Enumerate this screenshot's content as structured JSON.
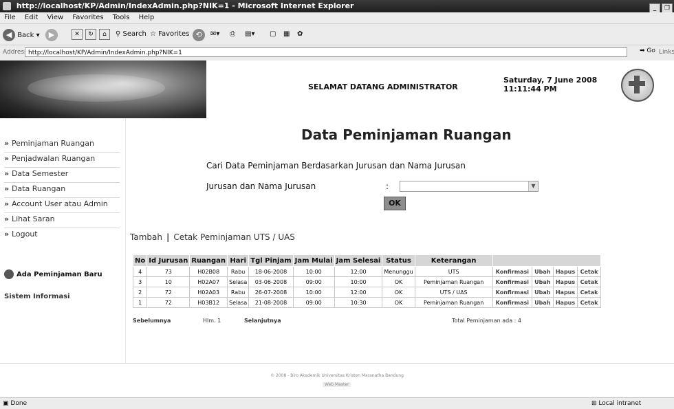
{
  "window": {
    "title": "http://localhost/KP/Admin/IndexAdmin.php?NIK=1 - Microsoft Internet Explorer"
  },
  "menu": [
    "File",
    "Edit",
    "View",
    "Favorites",
    "Tools",
    "Help"
  ],
  "toolbar": {
    "back": "Back",
    "search": "Search",
    "favorites": "Favorites"
  },
  "address": {
    "label": "Address",
    "url": "http://localhost/KP/Admin/IndexAdmin.php?NIK=1",
    "go": "Go",
    "links": "Links"
  },
  "header": {
    "welcome": "SELAMAT DATANG ADMINISTRATOR",
    "date": "Saturday, 7 June 2008",
    "time": "11:11:44 PM"
  },
  "sidebar": {
    "items": [
      {
        "label": "Peminjaman Ruangan"
      },
      {
        "label": "Penjadwalan Ruangan"
      },
      {
        "label": "Data Semester"
      },
      {
        "label": "Data Ruangan"
      },
      {
        "label": "Account User atau Admin"
      },
      {
        "label": "Lihat Saran"
      },
      {
        "label": "Logout"
      }
    ],
    "notice": "Ada Peminjaman Baru",
    "system": "Sistem Informasi"
  },
  "main": {
    "title": "Data Peminjaman Ruangan",
    "search_heading": "Cari Data Peminjaman Berdasarkan Jurusan dan Nama Jurusan",
    "field_label": "Jurusan dan Nama Jurusan",
    "colon": ":",
    "select_value": "",
    "ok": "OK",
    "add_link": "Tambah",
    "separator": "|",
    "print_link": "Cetak Peminjaman UTS / UAS"
  },
  "table": {
    "headers": [
      "No",
      "Id Jurusan",
      "Ruangan",
      "Hari",
      "Tgl Pinjam",
      "Jam Mulai",
      "Jam Selesai",
      "Status",
      "Keterangan",
      ""
    ],
    "rows": [
      {
        "no": "4",
        "id": "73",
        "ruangan": "H02B08",
        "hari": "Rabu",
        "tgl": "18-06-2008",
        "mulai": "10:00",
        "selesai": "12:00",
        "status": "Menunggu",
        "ket": "UTS"
      },
      {
        "no": "3",
        "id": "10",
        "ruangan": "H02A07",
        "hari": "Selasa",
        "tgl": "03-06-2008",
        "mulai": "09:00",
        "selesai": "10:00",
        "status": "OK",
        "ket": "Peminjaman Ruangan"
      },
      {
        "no": "2",
        "id": "72",
        "ruangan": "H02A03",
        "hari": "Rabu",
        "tgl": "26-07-2008",
        "mulai": "10:00",
        "selesai": "12:00",
        "status": "OK",
        "ket": "UTS / UAS"
      },
      {
        "no": "1",
        "id": "72",
        "ruangan": "H03B12",
        "hari": "Selasa",
        "tgl": "21-08-2008",
        "mulai": "09:00",
        "selesai": "10:30",
        "status": "OK",
        "ket": "Peminjaman Ruangan"
      }
    ],
    "actions": [
      "Konfirmasi",
      "Ubah",
      "Hapus",
      "Cetak"
    ]
  },
  "pager": {
    "prev": "Sebelumnya",
    "page": "Hlm. 1",
    "next": "Selanjutnya",
    "total": "Total Peminjaman ada : 4"
  },
  "footer": {
    "copyright": "© 2008 - Biro Akademik Universitas Kristen Maranatha Bandung",
    "webmaster": "Web Master"
  },
  "status": {
    "left": "Done",
    "zone": "Local intranet"
  }
}
